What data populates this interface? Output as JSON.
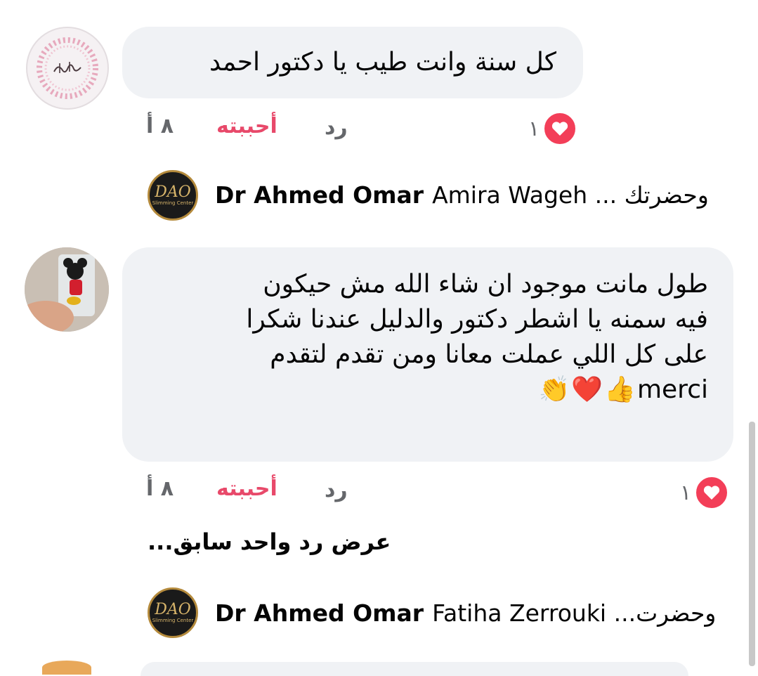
{
  "comments": [
    {
      "text_lines": [
        "كل سنة وانت طيب يا دكتور احمد"
      ],
      "reaction_count": "١",
      "reply_label": "رد",
      "like_label": "أحببته",
      "time": "٨ أ",
      "avatar_icon": "calligraphy-avatar-icon"
    },
    {
      "text_lines": [
        "طول مانت موجود   ان شاء الله مش حيكون",
        "فيه سمنه  يا اشطر دكتور  والدليل عندنا  شكرا",
        "على كل اللي عملت معانا  ومن تقدم لتقدم",
        "merci"
      ],
      "emojis": [
        "👍",
        "❤️",
        "👏"
      ],
      "reaction_count": "١",
      "reply_label": "رد",
      "like_label": "أحببته",
      "time": "٨ أ",
      "avatar_icon": "doll-photo-avatar-icon"
    }
  ],
  "replies": [
    {
      "author": "Dr Ahmed Omar",
      "preview": "Amira Wageh ... وحضرتك",
      "logo_text": "DAO",
      "logo_sub": "Slimming Center"
    },
    {
      "author": "Dr Ahmed Omar",
      "preview": "Fatiha Zerrouki ...وحضرت",
      "logo_text": "DAO",
      "logo_sub": "Slimming Center"
    }
  ],
  "view_previous": "عرض رد واحد سابق...",
  "colors": {
    "bubble": "#f0f2f5",
    "liked": "#e8496a",
    "heart": "#f33e58"
  }
}
